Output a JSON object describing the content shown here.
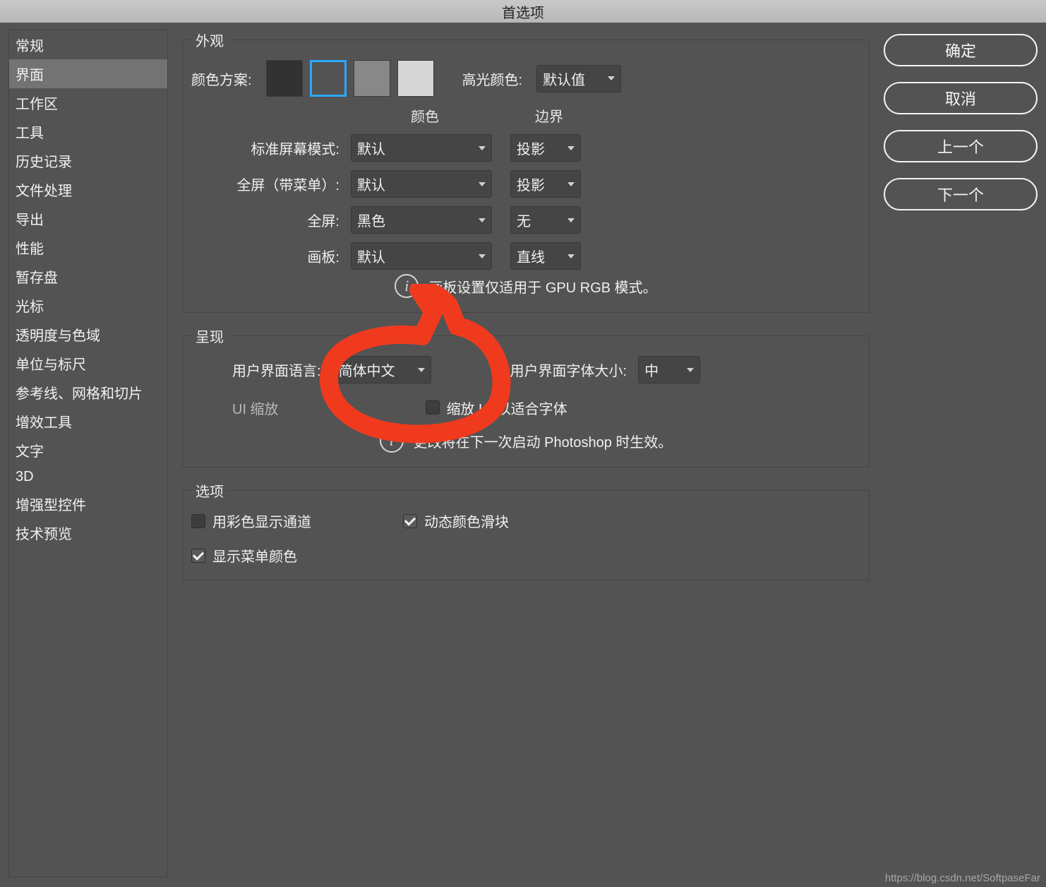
{
  "window_title": "首选项",
  "sidebar": {
    "items": [
      "常规",
      "界面",
      "工作区",
      "工具",
      "历史记录",
      "文件处理",
      "导出",
      "性能",
      "暂存盘",
      "光标",
      "透明度与色域",
      "单位与标尺",
      "参考线、网格和切片",
      "增效工具",
      "文字",
      "3D",
      "增强型控件",
      "技术预览"
    ],
    "selected_index": 1
  },
  "appearance": {
    "legend": "外观",
    "color_scheme_label": "颜色方案:",
    "swatch_colors": [
      "#323232",
      "#535353",
      "#888888",
      "#d6d6d6"
    ],
    "selected_swatch": 1,
    "highlight_label": "高光颜色:",
    "highlight_value": "默认值",
    "color_header": "颜色",
    "border_header": "边界",
    "rows": [
      {
        "label": "标准屏幕模式:",
        "color": "默认",
        "border": "投影"
      },
      {
        "label": "全屏（带菜单）:",
        "color": "默认",
        "border": "投影"
      },
      {
        "label": "全屏:",
        "color": "黑色",
        "border": "无"
      },
      {
        "label": "画板:",
        "color": "默认",
        "border": "直线"
      }
    ],
    "info_text": "画板设置仅适用于 GPU RGB 模式。"
  },
  "presentation": {
    "legend": "呈现",
    "lang_label": "用户界面语言:",
    "lang_value": "简体中文",
    "font_label": "用户界面字体大小:",
    "font_value": "中",
    "ui_scale_label": "UI 缩放",
    "scale_checkbox_label": "缩放 UI 以适合字体",
    "scale_checked": false,
    "info_text": "更改将在下一次启动 Photoshop 时生效。"
  },
  "options": {
    "legend": "选项",
    "opts": [
      {
        "label": "用彩色显示通道",
        "checked": false
      },
      {
        "label": "动态颜色滑块",
        "checked": true
      },
      {
        "label": "显示菜单颜色",
        "checked": true
      }
    ]
  },
  "buttons": {
    "ok": "确定",
    "cancel": "取消",
    "prev": "上一个",
    "next": "下一个"
  },
  "watermark": "https://blog.csdn.net/SoftpaseFar"
}
